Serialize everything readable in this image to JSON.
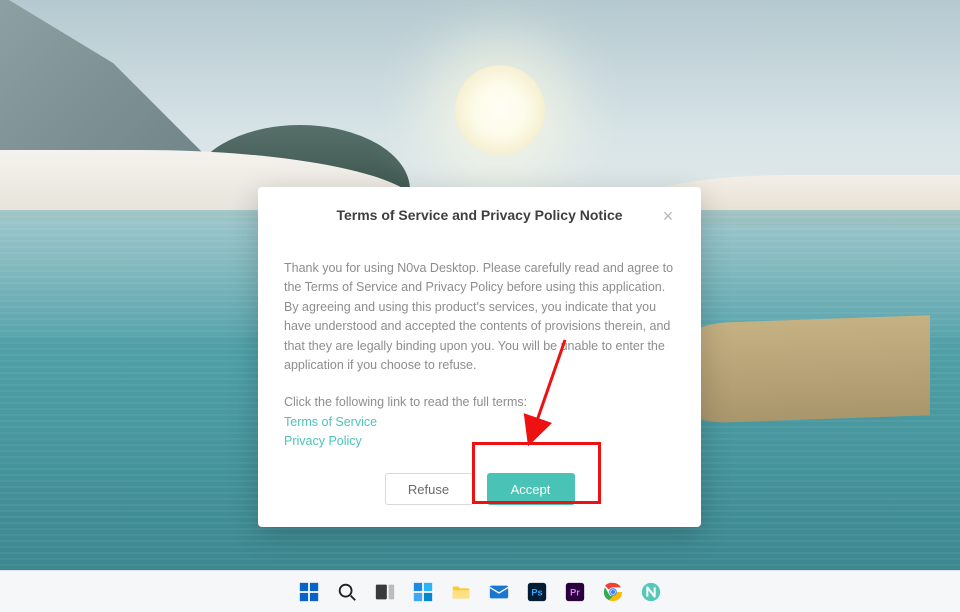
{
  "dialog": {
    "title": "Terms of Service and Privacy Policy Notice",
    "body_text": "Thank you for using N0va Desktop. Please carefully read and agree to the Terms of Service and Privacy Policy before using this application. By agreeing and using this product's services, you indicate that you have understood and accepted the contents of provisions therein, and that they are legally binding upon you. You will be unable to enter the application if you choose to refuse.",
    "links_prompt": "Click the following link to read the full terms:",
    "links": {
      "tos": "Terms of Service",
      "privacy": "Privacy Policy"
    },
    "buttons": {
      "refuse": "Refuse",
      "accept": "Accept"
    },
    "close_glyph": "×"
  },
  "taskbar": {
    "items": [
      {
        "name": "start-icon"
      },
      {
        "name": "search-icon"
      },
      {
        "name": "taskview-icon"
      },
      {
        "name": "widgets-icon"
      },
      {
        "name": "file-explorer-icon"
      },
      {
        "name": "mail-icon"
      },
      {
        "name": "photoshop-icon"
      },
      {
        "name": "premiere-icon"
      },
      {
        "name": "chrome-icon"
      },
      {
        "name": "nova-icon"
      }
    ]
  },
  "colors": {
    "accent": "#49c3b6",
    "annotation": "#ee1111"
  }
}
